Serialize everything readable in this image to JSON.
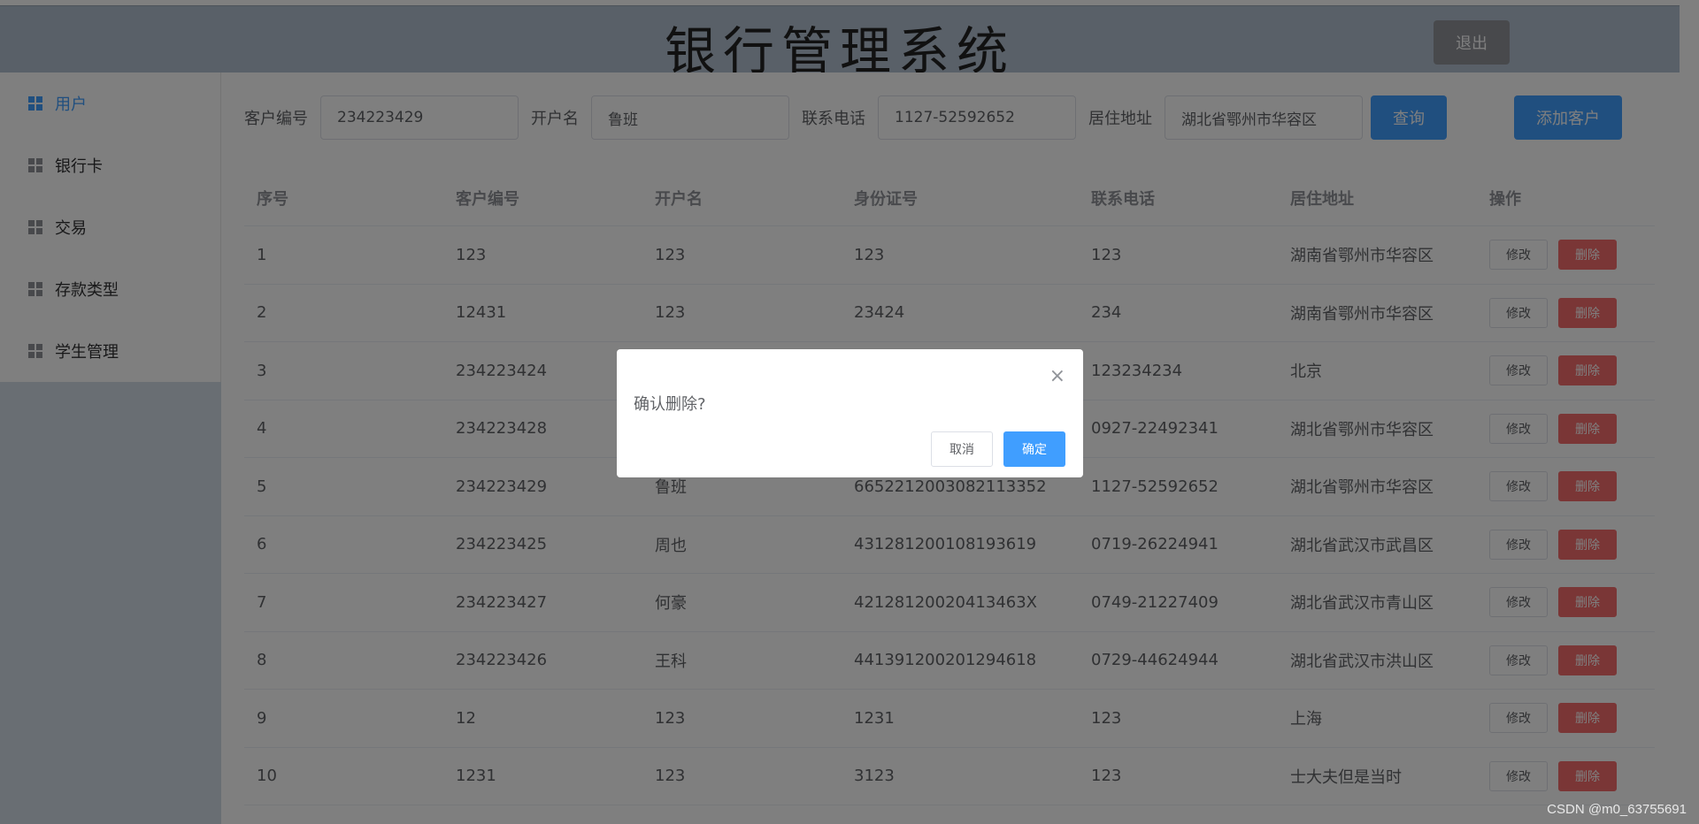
{
  "header": {
    "title": "银行管理系统",
    "logout_label": "退出"
  },
  "sidebar": {
    "items": [
      {
        "label": "用户",
        "active": true
      },
      {
        "label": "银行卡",
        "active": false
      },
      {
        "label": "交易",
        "active": false
      },
      {
        "label": "存款类型",
        "active": false
      },
      {
        "label": "学生管理",
        "active": false
      }
    ]
  },
  "search": {
    "customer_id_label": "客户编号",
    "customer_id_value": "234223429",
    "name_label": "开户名",
    "name_value": "鲁班",
    "phone_label": "联系电话",
    "phone_value": "1127-52592652",
    "address_label": "居住地址",
    "address_value": "湖北省鄂州市华容区",
    "query_label": "查询",
    "add_label": "添加客户"
  },
  "table": {
    "headers": [
      "序号",
      "客户编号",
      "开户名",
      "身份证号",
      "联系电话",
      "居住地址",
      "操作"
    ],
    "edit_label": "修改",
    "delete_label": "删除",
    "rows": [
      [
        "1",
        "123",
        "123",
        "123",
        "123",
        "湖南省鄂州市华容区"
      ],
      [
        "2",
        "12431",
        "123",
        "23424",
        "234",
        "湖南省鄂州市华容区"
      ],
      [
        "3",
        "234223424",
        "",
        "",
        "123234234",
        "北京"
      ],
      [
        "4",
        "234223428",
        "",
        "",
        "0927-22492341",
        "湖北省鄂州市华容区"
      ],
      [
        "5",
        "234223429",
        "鲁班",
        "6652212003082113352",
        "1127-52592652",
        "湖北省鄂州市华容区"
      ],
      [
        "6",
        "234223425",
        "周也",
        "431281200108193619",
        "0719-26224941",
        "湖北省武汉市武昌区"
      ],
      [
        "7",
        "234223427",
        "何豪",
        "42128120020413463X",
        "0749-21227409",
        "湖北省武汉市青山区"
      ],
      [
        "8",
        "234223426",
        "王科",
        "441391200201294618",
        "0729-44624944",
        "湖北省武汉市洪山区"
      ],
      [
        "9",
        "12",
        "123",
        "1231",
        "123",
        "上海"
      ],
      [
        "10",
        "1231",
        "123",
        "3123",
        "123",
        "士大夫但是当时"
      ]
    ]
  },
  "dialog": {
    "message": "确认删除?",
    "cancel_label": "取消",
    "ok_label": "确定",
    "close_glyph": "×"
  },
  "watermark": "CSDN @m0_63755691",
  "colors": {
    "primary": "#409eff",
    "danger": "#f56c6c",
    "header_bg": "#b3c0d1",
    "sidebar_bg": "#d3dce6"
  }
}
